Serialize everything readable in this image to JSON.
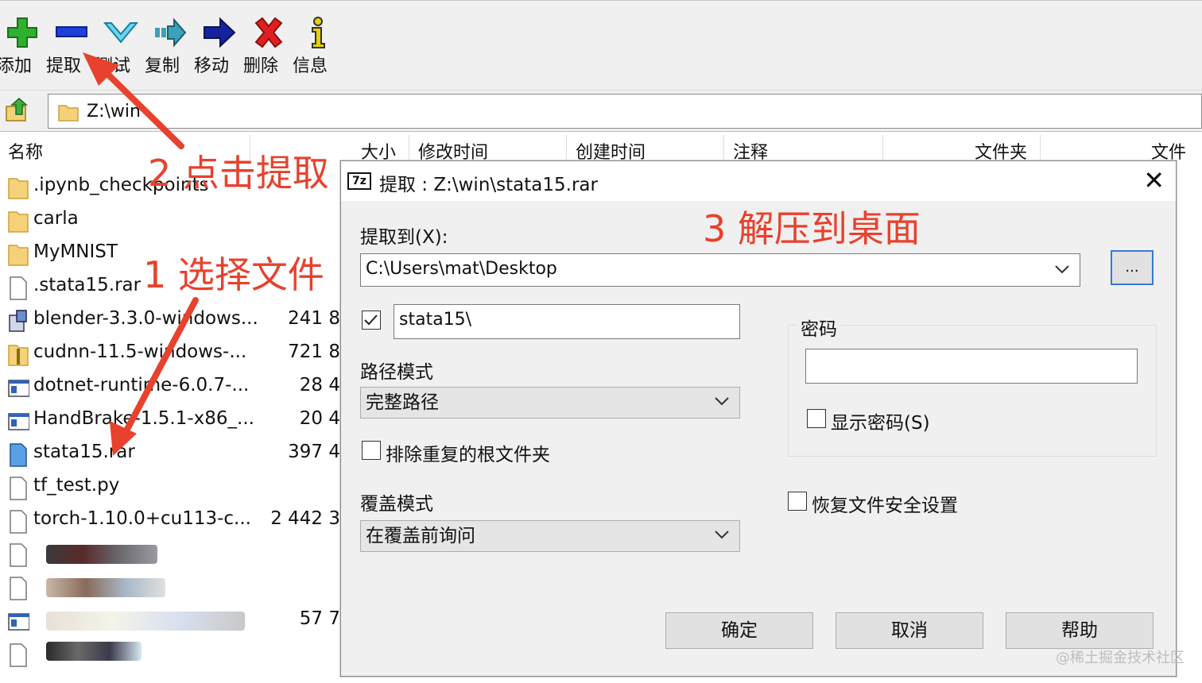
{
  "toolbar": {
    "buttons": [
      {
        "label": "添加",
        "icon": "add-icon"
      },
      {
        "label": "提取",
        "icon": "extract-icon"
      },
      {
        "label": "测试",
        "icon": "test-icon"
      },
      {
        "label": "复制",
        "icon": "copy-icon"
      },
      {
        "label": "移动",
        "icon": "move-icon"
      },
      {
        "label": "删除",
        "icon": "delete-icon"
      },
      {
        "label": "信息",
        "icon": "info-icon"
      }
    ]
  },
  "address": {
    "path": "Z:\\win"
  },
  "list": {
    "columns": [
      "名称",
      "大小",
      "修改时间",
      "创建时间",
      "注释",
      "文件夹",
      "文件"
    ],
    "rows": [
      {
        "name": ".ipynb_checkpoints",
        "size": "",
        "icon": "folder-icon"
      },
      {
        "name": "carla",
        "size": "",
        "icon": "folder-icon"
      },
      {
        "name": "MyMNIST",
        "size": "",
        "icon": "folder-icon"
      },
      {
        "name": ".stata15.rar",
        "size": "",
        "icon": "file-icon"
      },
      {
        "name": "blender-3.3.0-windows...",
        "size": "241 8",
        "icon": "installer-icon"
      },
      {
        "name": "cudnn-11.5-windows-...",
        "size": "721 8",
        "icon": "zip-icon"
      },
      {
        "name": "dotnet-runtime-6.0.7-...",
        "size": "28 4",
        "icon": "exe-icon"
      },
      {
        "name": "HandBrake-1.5.1-x86_...",
        "size": "20 4",
        "icon": "exe-icon"
      },
      {
        "name": "stata15.rar",
        "size": "397 4",
        "icon": "archive-icon"
      },
      {
        "name": "tf_test.py",
        "size": "",
        "icon": "file-icon"
      },
      {
        "name": "torch-1.10.0+cu113-c...",
        "size": "2 442 3",
        "icon": "file-icon"
      },
      {
        "name": "",
        "size": "",
        "icon": "file-icon"
      },
      {
        "name": "",
        "size": "",
        "icon": "file-icon"
      },
      {
        "name": "",
        "size": "57 7",
        "icon": "exe-icon"
      },
      {
        "name": "",
        "size": "",
        "icon": "file-icon"
      }
    ]
  },
  "dialog": {
    "title": "提取 : Z:\\win\\stata15.rar",
    "logo": "7z",
    "extract_to_label": "提取到(X):",
    "extract_to_value": "C:\\Users\\mat\\Desktop",
    "browse_label": "...",
    "subfolder_value": "stata15\\",
    "subfolder_checked": true,
    "path_mode_label": "路径模式",
    "path_mode_value": "完整路径",
    "eliminate_root_label": "排除重复的根文件夹",
    "overwrite_mode_label": "覆盖模式",
    "overwrite_mode_value": "在覆盖前询问",
    "password_label": "密码",
    "show_password_label": "显示密码(S)",
    "restore_security_label": "恢复文件安全设置",
    "ok_label": "确定",
    "cancel_label": "取消",
    "help_label": "帮助"
  },
  "annotations": {
    "step1": "1 选择文件",
    "step2": "2 点击提取",
    "step3": "3 解压到桌面",
    "color": "#e8412d"
  },
  "watermark": "@稀土掘金技术社区"
}
